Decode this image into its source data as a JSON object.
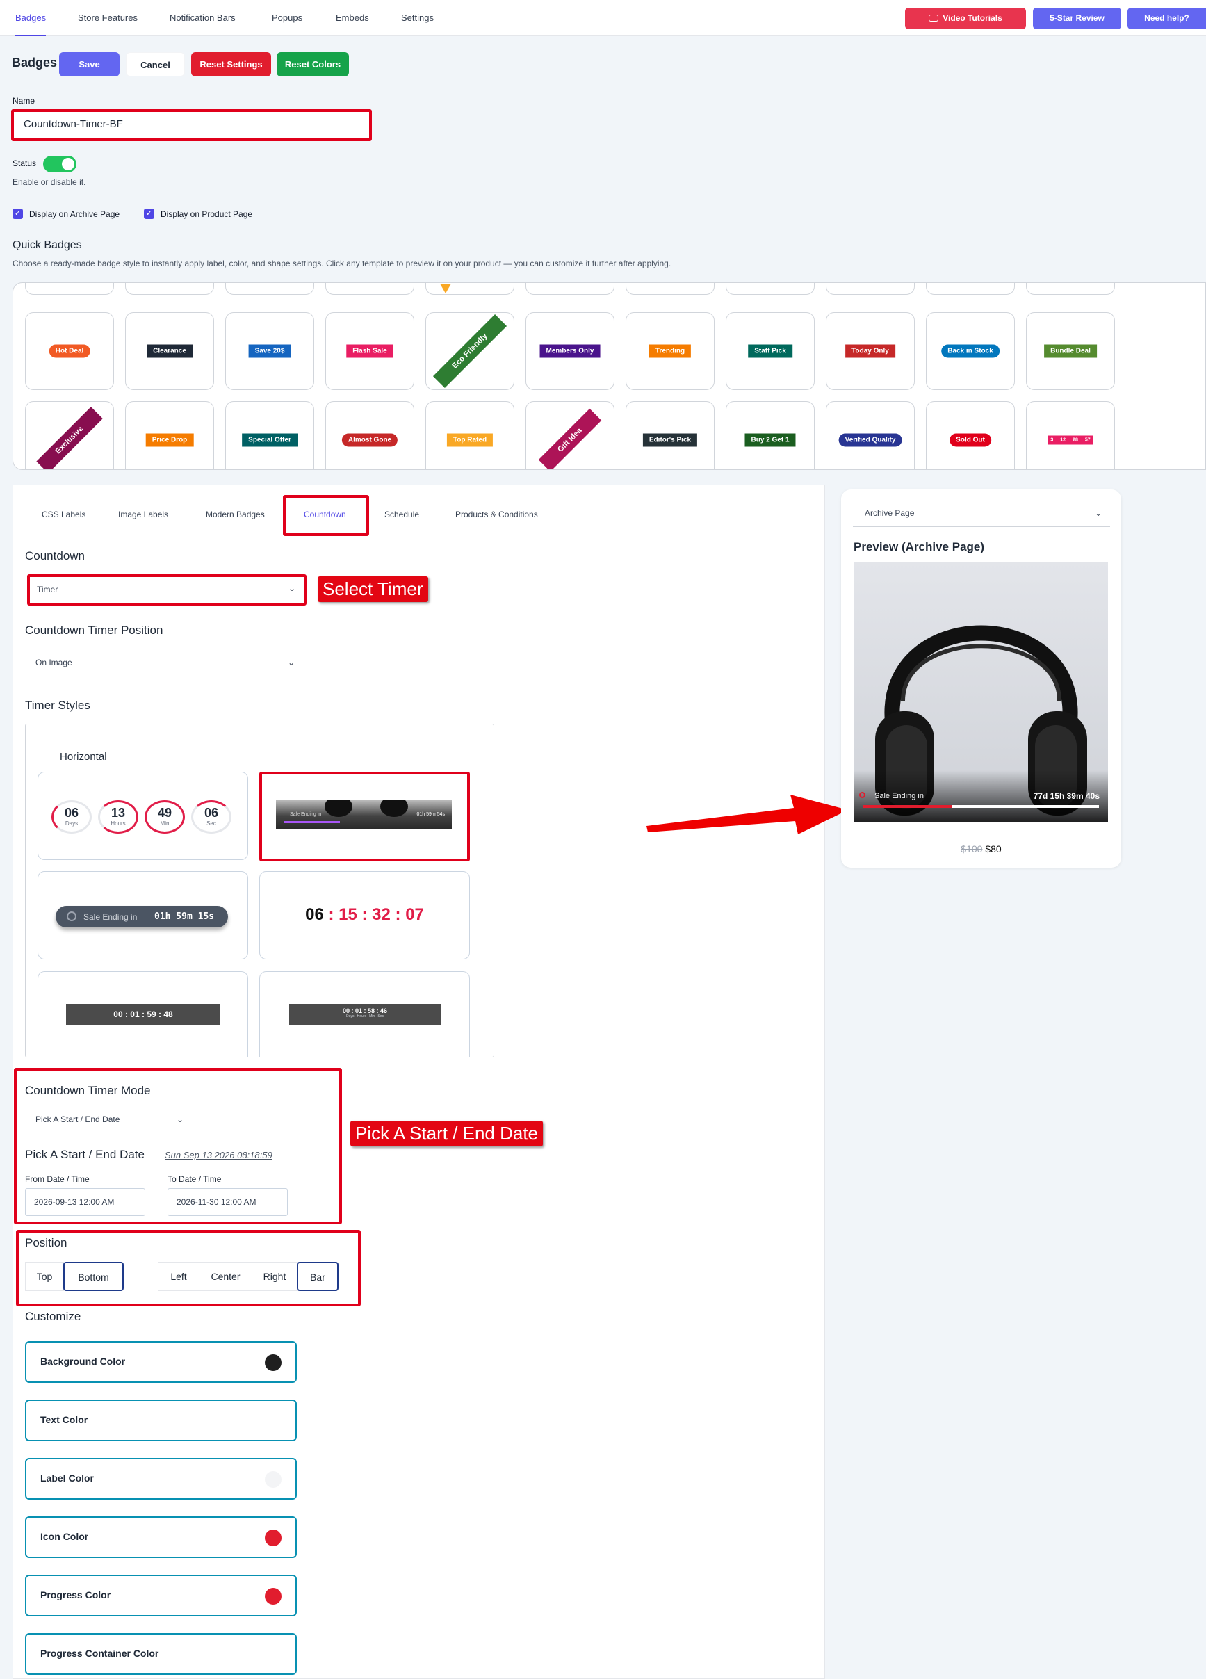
{
  "topnav": {
    "tabs": [
      "Badges",
      "Store Features",
      "Notification Bars",
      "Popups",
      "Embeds",
      "Settings"
    ],
    "video_tutorials": "Video Tutorials",
    "review": "5-Star Review",
    "help": "Need help?"
  },
  "header": {
    "title": "Badges",
    "save": "Save",
    "cancel": "Cancel",
    "reset_settings": "Reset Settings",
    "reset_colors": "Reset Colors"
  },
  "form": {
    "name_label": "Name",
    "name_value": "Countdown-Timer-BF",
    "status_label": "Status",
    "status_hint": "Enable or disable it.",
    "status_on": true,
    "archive_label": "Display on Archive Page",
    "product_label": "Display on Product Page"
  },
  "quick": {
    "title": "Quick Badges",
    "desc": "Choose a ready-made badge style to instantly apply label, color, and shape settings. Click any template to preview it on your product — you can customize it further after applying.",
    "row1": [
      {
        "label": "Hot Deal",
        "color": "#f15a24"
      },
      {
        "label": "Clearance",
        "color": "#1f2937"
      },
      {
        "label": "Save 20$",
        "color": "#1565c0"
      },
      {
        "label": "Flash Sale",
        "color": "#e91e63"
      },
      {
        "label": "Eco Friendly",
        "color": "#2e7d32"
      },
      {
        "label": "Members Only",
        "color": "#4a148c"
      },
      {
        "label": "Trending",
        "color": "#f57c00"
      },
      {
        "label": "Staff Pick",
        "color": "#00695c"
      },
      {
        "label": "Today Only",
        "color": "#c62828"
      },
      {
        "label": "Back in Stock",
        "color": "#0277bd"
      },
      {
        "label": "Bundle Deal",
        "color": "#558b2f"
      }
    ],
    "row2": [
      {
        "label": "Exclusive",
        "color": "#880e4f"
      },
      {
        "label": "Price Drop",
        "color": "#f57c00"
      },
      {
        "label": "Special Offer",
        "color": "#006064"
      },
      {
        "label": "Almost Gone",
        "color": "#c62828"
      },
      {
        "label": "Top Rated",
        "color": "#f9a825"
      },
      {
        "label": "Gift Idea",
        "color": "#ad1457"
      },
      {
        "label": "Editor's Pick",
        "color": "#263238"
      },
      {
        "label": "Buy 2 Get 1",
        "color": "#1b5e20"
      },
      {
        "label": "Verified Quality",
        "color": "#283593"
      },
      {
        "label": "Sold Out",
        "color": "#e0001b"
      },
      {
        "label": "",
        "color": "#e91e63"
      }
    ],
    "mini_timer": [
      "3",
      "12",
      "28",
      "57"
    ]
  },
  "subtabs": [
    "CSS Labels",
    "Image Labels",
    "Modern Badges",
    "Countdown",
    "Schedule",
    "Products & Conditions"
  ],
  "countdown": {
    "title": "Countdown",
    "select_value": "Timer",
    "callout_timer": "Select Timer",
    "position_title": "Countdown Timer Position",
    "position_value": "On Image",
    "styles_title": "Timer Styles",
    "horizontal": "Horizontal",
    "circles": [
      {
        "n": "06",
        "u": "Days"
      },
      {
        "n": "13",
        "u": "Hours"
      },
      {
        "n": "49",
        "u": "Min"
      },
      {
        "n": "06",
        "u": "Sec"
      }
    ],
    "bar_text": "Sale Ending in",
    "bar_time": "01h 59m 54s",
    "pill_text": "Sale Ending in",
    "pill_time": "01h 59m 15s",
    "big_days": "06",
    "big_rest": ": 15 : 32 : 07",
    "flat_time": "00 : 01 : 59 : 48",
    "flat_time2": "00 : 01 : 58 : 46",
    "flat_units": "Days   Hours   Min   Sec"
  },
  "mode": {
    "title": "Countdown Timer Mode",
    "select_value": "Pick A Start / End Date",
    "pick_title": "Pick A Start / End Date",
    "pick_date": "Sun Sep 13 2026 08:18:59",
    "from_label": "From Date / Time",
    "from_value": "2026-09-13 12:00 AM",
    "to_label": "To Date / Time",
    "to_value": "2026-11-30 12:00 AM",
    "callout": "Pick A Start / End Date"
  },
  "position": {
    "title": "Position",
    "vertical": [
      "Top",
      "Bottom"
    ],
    "horizontal": [
      "Left",
      "Center",
      "Right",
      "Bar"
    ]
  },
  "customize": {
    "title": "Customize",
    "items": [
      {
        "label": "Background Color",
        "color": "#1f1f1f"
      },
      {
        "label": "Text Color",
        "color": "#ffffff"
      },
      {
        "label": "Label Color",
        "color": "#f3f4f6"
      },
      {
        "label": "Icon Color",
        "color": "#e11d2e"
      },
      {
        "label": "Progress Color",
        "color": "#e11d2e"
      },
      {
        "label": "Progress Container Color",
        "color": "#ffffff"
      }
    ]
  },
  "preview": {
    "select_value": "Archive Page",
    "title": "Preview (Archive Page)",
    "bar_text": "Sale Ending in",
    "bar_time": "77d 15h 39m 40s",
    "old_price": "$100",
    "new_price": "$80",
    "progress": 0.38
  }
}
